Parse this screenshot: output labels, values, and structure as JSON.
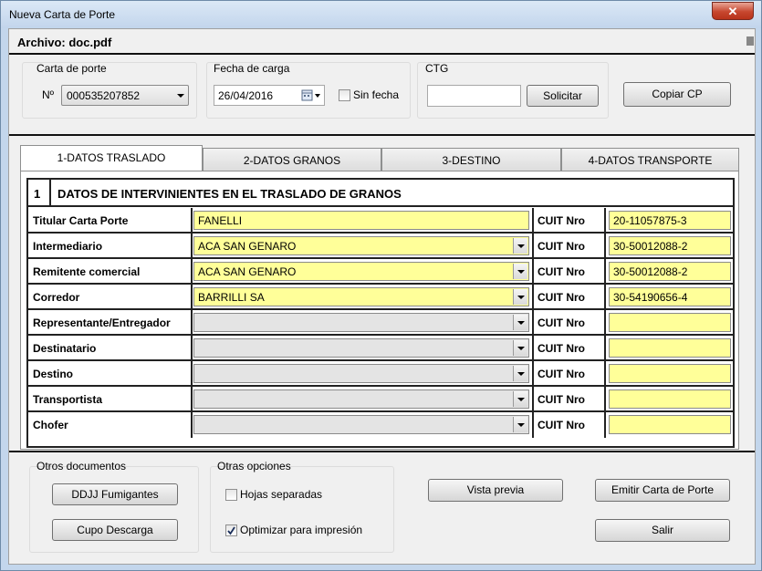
{
  "window": {
    "title": "Nueva Carta de Porte",
    "close_label": "✕"
  },
  "archivo": {
    "label": "Archivo: doc.pdf"
  },
  "carta_de_porte": {
    "group_label": "Carta de porte",
    "number_label": "Nº",
    "number_value": "000535207852"
  },
  "fecha_de_carga": {
    "group_label": "Fecha de carga",
    "value": "26/04/2016",
    "sin_fecha_label": "Sin fecha",
    "sin_fecha_checked": false
  },
  "ctg": {
    "group_label": "CTG",
    "value": "",
    "solicitar_label": "Solicitar"
  },
  "copiar_cp_label": "Copiar CP",
  "tabs": [
    {
      "label": "1-DATOS TRASLADO",
      "active": true
    },
    {
      "label": "2-DATOS GRANOS",
      "active": false
    },
    {
      "label": "3-DESTINO",
      "active": false
    },
    {
      "label": "4-DATOS TRANSPORTE",
      "active": false
    }
  ],
  "section": {
    "number": "1",
    "title": "DATOS DE INTERVINIENTES EN EL TRASLADO DE GRANOS"
  },
  "cuit_label": "CUIT Nro",
  "rows": [
    {
      "label": "Titular Carta Porte",
      "value": "FANELLI",
      "cuit": "20-11057875-3",
      "style": "plain"
    },
    {
      "label": "Intermediario",
      "value": "ACA SAN GENARO",
      "cuit": "30-50012088-2",
      "style": "combo"
    },
    {
      "label": "Remitente comercial",
      "value": "ACA SAN GENARO",
      "cuit": "30-50012088-2",
      "style": "combo"
    },
    {
      "label": "Corredor",
      "value": "BARRILLI SA",
      "cuit": "30-54190656-4",
      "style": "combo"
    },
    {
      "label": "Representante/Entregador",
      "value": "",
      "cuit": "",
      "style": "empty"
    },
    {
      "label": "Destinatario",
      "value": "",
      "cuit": "",
      "style": "empty"
    },
    {
      "label": "Destino",
      "value": "",
      "cuit": "",
      "style": "empty"
    },
    {
      "label": "Transportista",
      "value": "",
      "cuit": "",
      "style": "empty"
    },
    {
      "label": "Chofer",
      "value": "",
      "cuit": "",
      "style": "empty"
    }
  ],
  "otros_documentos": {
    "group_label": "Otros documentos",
    "ddjj_label": "DDJJ Fumigantes",
    "cupo_label": "Cupo Descarga"
  },
  "otras_opciones": {
    "group_label": "Otras opciones",
    "hojas_label": "Hojas separadas",
    "hojas_checked": false,
    "optimizar_label": "Optimizar para impresión",
    "optimizar_checked": true
  },
  "vista_previa_label": "Vista previa",
  "emitir_label": "Emitir Carta de Porte",
  "salir_label": "Salir"
}
